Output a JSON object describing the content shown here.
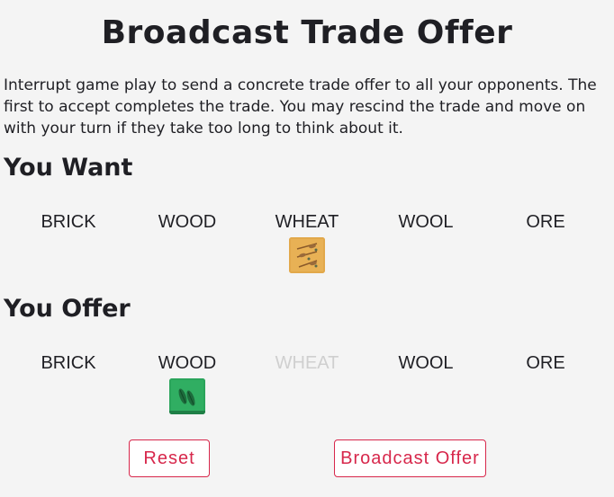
{
  "dialog": {
    "title": "Broadcast Trade Offer",
    "description": "Interrupt game play to send a concrete trade offer to all your opponents. The first to accept completes the trade. You may rescind the trade and move on with your turn if they take too long to think about it."
  },
  "want": {
    "heading": "You Want",
    "resources": [
      {
        "label": "BRICK",
        "count": 0,
        "enabled": true
      },
      {
        "label": "WOOD",
        "count": 0,
        "enabled": true
      },
      {
        "label": "WHEAT",
        "count": 1,
        "enabled": true
      },
      {
        "label": "WOOL",
        "count": 0,
        "enabled": true
      },
      {
        "label": "ORE",
        "count": 0,
        "enabled": true
      }
    ]
  },
  "offer": {
    "heading": "You Offer",
    "resources": [
      {
        "label": "BRICK",
        "count": 0,
        "enabled": true
      },
      {
        "label": "WOOD",
        "count": 1,
        "enabled": true
      },
      {
        "label": "WHEAT",
        "count": 0,
        "enabled": false
      },
      {
        "label": "WOOL",
        "count": 0,
        "enabled": true
      },
      {
        "label": "ORE",
        "count": 0,
        "enabled": true
      }
    ]
  },
  "buttons": {
    "reset": "Reset",
    "broadcast": "Broadcast Offer"
  },
  "colors": {
    "accent": "#d7274b",
    "wheat_card": "#e2a84a",
    "wood_card": "#2aa45b",
    "disabled_text": "#cfcfcf"
  },
  "icons": {
    "wheat_card": "wheat-card-icon",
    "wood_card": "wood-card-icon"
  }
}
